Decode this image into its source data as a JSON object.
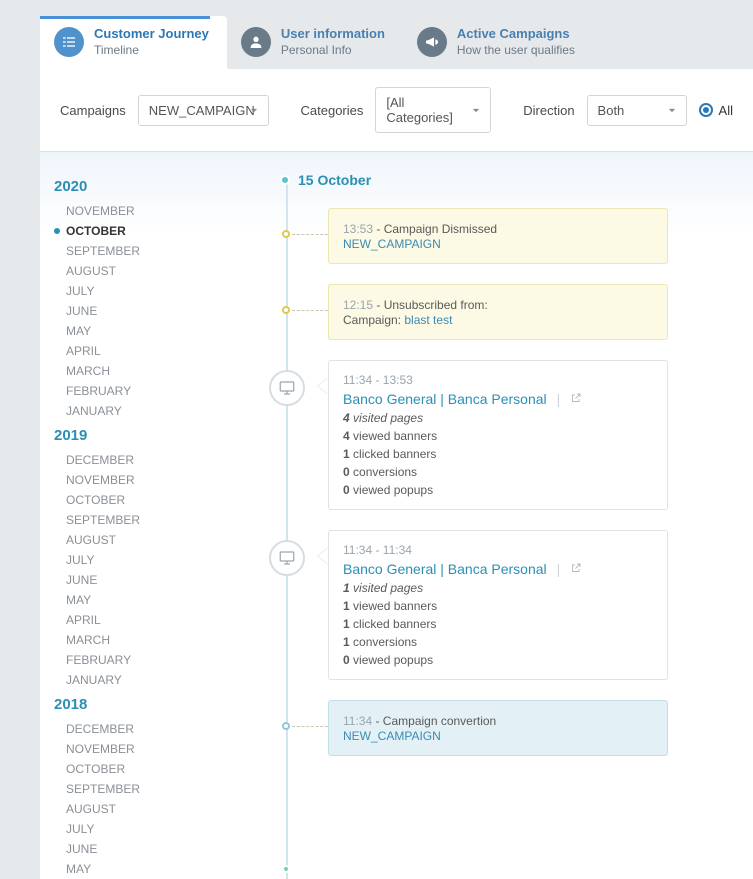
{
  "tabs": [
    {
      "title": "Customer Journey",
      "sub": "Timeline"
    },
    {
      "title": "User information",
      "sub": "Personal Info"
    },
    {
      "title": "Active Campaigns",
      "sub": "How the user qualifies"
    }
  ],
  "filters": {
    "campaignsLabel": "Campaigns",
    "campaignValue": "NEW_CAMPAIGN",
    "categoriesLabel": "Categories",
    "categoryValue": "[All Categories]",
    "directionLabel": "Direction",
    "directionValue": "Both",
    "allLabel": "All"
  },
  "sidebar": [
    {
      "year": "2020",
      "months": [
        "NOVEMBER",
        "OCTOBER",
        "SEPTEMBER",
        "AUGUST",
        "JULY",
        "JUNE",
        "MAY",
        "APRIL",
        "MARCH",
        "FEBRUARY",
        "JANUARY"
      ],
      "active": "OCTOBER"
    },
    {
      "year": "2019",
      "months": [
        "DECEMBER",
        "NOVEMBER",
        "OCTOBER",
        "SEPTEMBER",
        "AUGUST",
        "JULY",
        "JUNE",
        "MAY",
        "APRIL",
        "MARCH",
        "FEBRUARY",
        "JANUARY"
      ]
    },
    {
      "year": "2018",
      "months": [
        "DECEMBER",
        "NOVEMBER",
        "OCTOBER",
        "SEPTEMBER",
        "AUGUST",
        "JULY",
        "JUNE",
        "MAY"
      ]
    }
  ],
  "timeline": {
    "date": "15 October",
    "events": [
      {
        "type": "yellow",
        "time": "13:53",
        "text": "Campaign Dismissed",
        "campaign": "NEW_CAMPAIGN"
      },
      {
        "type": "yellow",
        "time": "12:15",
        "text": "Unsubscribed from:",
        "sublabel": "Campaign:",
        "link": "blast test"
      },
      {
        "type": "session",
        "time": "11:34 - 13:53",
        "title": "Banco General | Banca Personal",
        "stats": [
          {
            "n": "4",
            "t": "visited pages",
            "i": true
          },
          {
            "n": "4",
            "t": "viewed banners"
          },
          {
            "n": "1",
            "t": "clicked banners"
          },
          {
            "n": "0",
            "t": "conversions"
          },
          {
            "n": "0",
            "t": "viewed popups"
          }
        ]
      },
      {
        "type": "session",
        "time": "11:34 - 11:34",
        "title": "Banco General | Banca Personal",
        "stats": [
          {
            "n": "1",
            "t": "visited pages",
            "i": true
          },
          {
            "n": "1",
            "t": "viewed banners"
          },
          {
            "n": "1",
            "t": "clicked banners"
          },
          {
            "n": "1",
            "t": "conversions"
          },
          {
            "n": "0",
            "t": "viewed popups"
          }
        ]
      },
      {
        "type": "blue",
        "time": "11:34",
        "text": "Campaign convertion",
        "campaign": "NEW_CAMPAIGN"
      }
    ]
  }
}
